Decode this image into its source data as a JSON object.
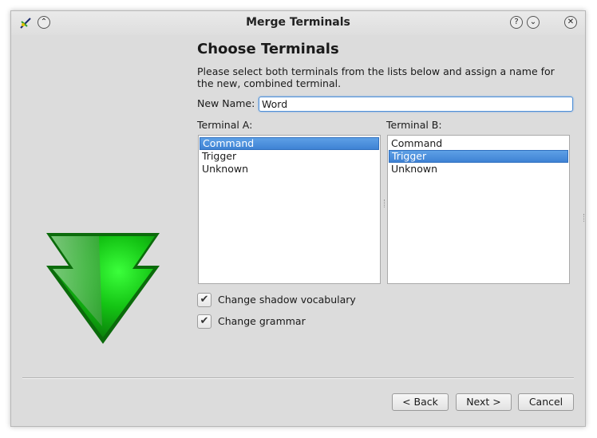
{
  "window": {
    "title": "Merge Terminals",
    "help_icon": "question-icon",
    "minimize_icon": "chevron-down-icon",
    "close_icon": "close-icon",
    "shade_icon": "chevron-up-double-icon",
    "app_icon": "app-logo-icon"
  },
  "page": {
    "heading": "Choose Terminals",
    "description": "Please select both terminals from the lists below and assign a name for the new, combined terminal.",
    "graphic": "green-merge-arrow-icon"
  },
  "form": {
    "new_name_label": "New Name:",
    "new_name_value": "Word",
    "terminal_a_label": "Terminal A:",
    "terminal_b_label": "Terminal B:",
    "terminal_a_items": [
      "Command",
      "Trigger",
      "Unknown"
    ],
    "terminal_a_selected": "Command",
    "terminal_b_items": [
      "Command",
      "Trigger",
      "Unknown"
    ],
    "terminal_b_selected": "Trigger",
    "shadow_vocab_label": "Change shadow vocabulary",
    "shadow_vocab_checked": true,
    "grammar_label": "Change grammar",
    "grammar_checked": true
  },
  "buttons": {
    "back": "< Back",
    "next": "Next >",
    "cancel": "Cancel"
  },
  "colors": {
    "selection": "#3f82d4",
    "arrow_green": "#1fa51f",
    "window_bg": "#dcdcdc"
  }
}
